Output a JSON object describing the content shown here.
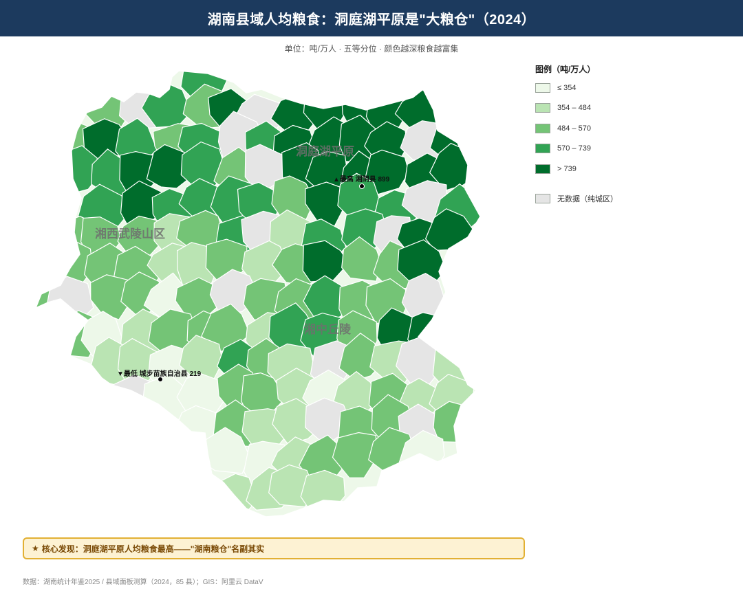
{
  "header": {
    "title": "湖南县域人均粮食：洞庭湖平原是\"大粮仓\"（2024）"
  },
  "subtitle": "单位：吨/万人 · 五等分位 · 颜色越深粮食越富集",
  "map": {
    "region_labels": [
      "洞庭湖平原",
      "湘西武陵山区",
      "湘中丘陵"
    ],
    "markers": [
      {
        "label": "▲最高 湘阴县 899",
        "kind": "max"
      },
      {
        "label": "▼最低 城步苗族自治县 219",
        "kind": "min"
      }
    ],
    "colors": {
      "class1": "#edf8e9",
      "class2": "#bae4b3",
      "class3": "#74c476",
      "class4": "#31a354",
      "class5": "#006d2c",
      "nodata": "#e5e5e5"
    }
  },
  "legend": {
    "title": "图例（吨/万人）",
    "items": [
      {
        "label": "≤ 354",
        "color": "#edf8e9"
      },
      {
        "label": "354 – 484",
        "color": "#bae4b3"
      },
      {
        "label": "484 – 570",
        "color": "#74c476"
      },
      {
        "label": "570 – 739",
        "color": "#31a354"
      },
      {
        "label": "> 739",
        "color": "#006d2c"
      }
    ],
    "nodata": {
      "label": "无数据（纯城区）",
      "color": "#e5e5e5"
    }
  },
  "finding": {
    "star": "★",
    "text": "核心发现：洞庭湖平原人均粮食最高——\"湖南粮仓\"名副其实"
  },
  "source": "数据：湖南统计年鉴2025 / 县域面板测算（2024，85 县）；GIS：阿里云 DataV"
}
